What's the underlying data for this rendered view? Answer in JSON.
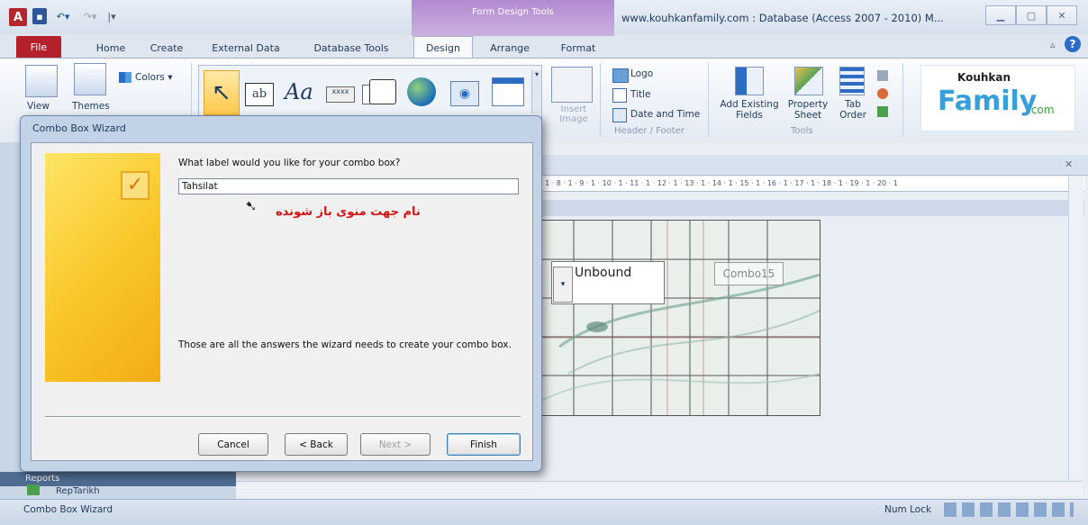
{
  "titlebar": {
    "context_tab": "Form Design Tools",
    "window_title": "www.kouhkanfamily.com : Database (Access 2007 - 2010) M...",
    "min_label": "▭",
    "max_label": "▣",
    "close_label": "ΣΣ"
  },
  "tabs": [
    "File",
    "Home",
    "Create",
    "External Data",
    "Database Tools",
    "Design",
    "Arrange",
    "Format"
  ],
  "ribbon": {
    "colors_label": "Colors ▾",
    "view_label": "View",
    "themes_label": "Themes",
    "insert_image_label": "Insert Image",
    "logo_label": "Logo",
    "title_label": "Title",
    "date_time_label": "Date and Time",
    "header_footer_group": "Header / Footer",
    "add_fields_label": "Add Existing Fields",
    "property_sheet_label": "Property Sheet",
    "tab_order_label": "Tab Order",
    "tools_group": "Tools",
    "logo_brand_top": "Kouhkan",
    "logo_brand_main": "Family",
    "logo_brand_suffix": ".com"
  },
  "dialog": {
    "title": "Combo Box Wizard",
    "prompt": "What label would you like for your combo box?",
    "input_value": "Tahsilat",
    "annotation": "نام جهت منوی باز شونده",
    "info": "Those are all the answers the wizard needs to create your combo box.",
    "buttons": {
      "cancel": "Cancel",
      "back": "< Back",
      "next": "Next >",
      "finish": "Finish"
    }
  },
  "form": {
    "combo_text": "Unbound",
    "combo_label": "Combo15",
    "ruler": "· 1 · 8 · 1 · 9 · 1 · 10 · 1 · 11 · 1 · 12 · 1 · 13 · 1 · 14 · 1 · 15 · 1 · 16 · 1 · 17 · 1 · 18 · 1 · 19 · 1 · 20 · 1"
  },
  "nav": {
    "section": "Reports",
    "item": "RepTarikh"
  },
  "status": {
    "left": "Combo Box Wizard",
    "numlock": "Num Lock"
  }
}
